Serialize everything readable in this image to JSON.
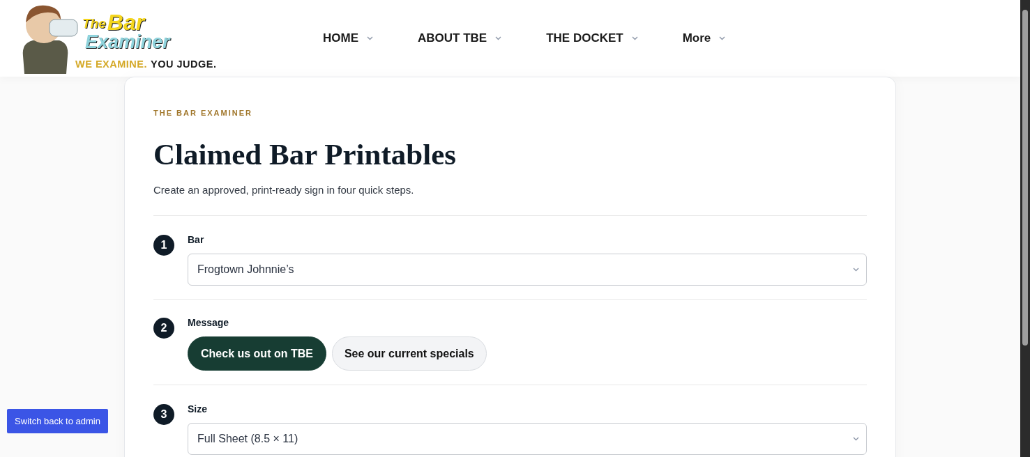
{
  "header": {
    "logo": {
      "word_1": "The",
      "word_2": "Bar",
      "word_3": "Examiner",
      "tagline_highlight": "WE EXAMINE.",
      "tagline_rest": "YOU JUDGE."
    },
    "nav": [
      {
        "label": "HOME"
      },
      {
        "label": "ABOUT TBE"
      },
      {
        "label": "THE DOCKET"
      },
      {
        "label": "More"
      }
    ]
  },
  "card": {
    "eyebrow": "THE BAR EXAMINER",
    "title": "Claimed Bar Printables",
    "subtitle": "Create an approved, print-ready sign in four quick steps.",
    "steps": [
      {
        "number": "1",
        "label": "Bar",
        "kind": "select",
        "value": "Frogtown Johnnie’s"
      },
      {
        "number": "2",
        "label": "Message",
        "kind": "choice",
        "options": [
          {
            "label": "Check us out on TBE",
            "selected": true
          },
          {
            "label": "See our current specials",
            "selected": false
          }
        ]
      },
      {
        "number": "3",
        "label": "Size",
        "kind": "select",
        "value": "Full Sheet (8.5 × 11)"
      }
    ]
  },
  "admin_button": "Switch back to admin"
}
